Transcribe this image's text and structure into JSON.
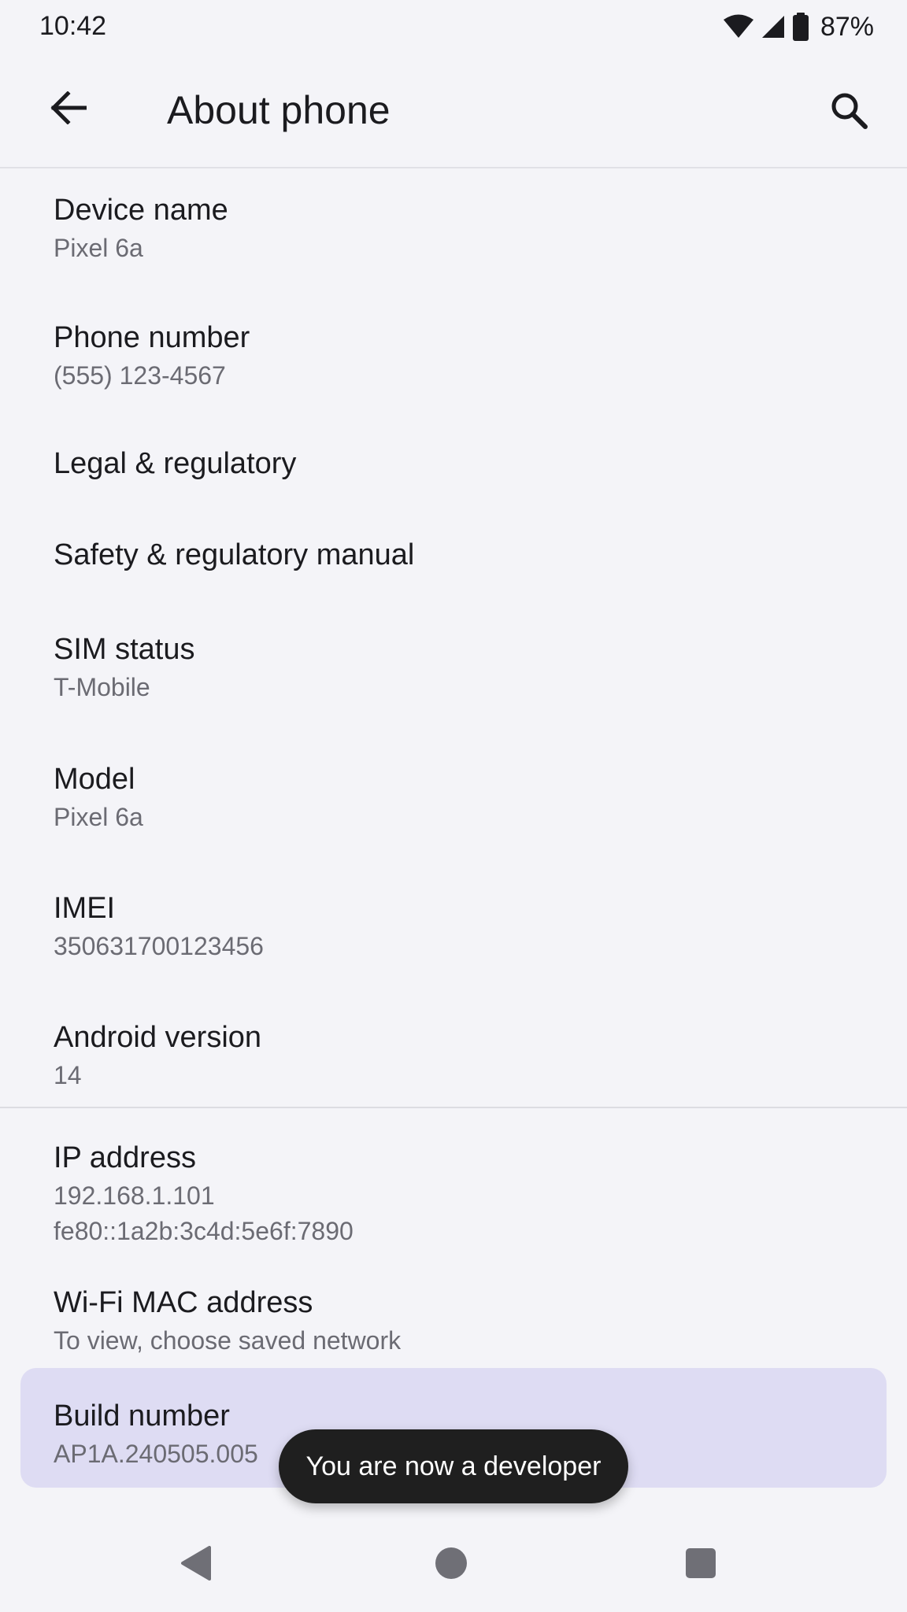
{
  "status_bar": {
    "time": "10:42",
    "battery": "87%",
    "icons": [
      "wifi-icon",
      "cell-signal-icon",
      "battery-icon"
    ]
  },
  "app_bar": {
    "title": "About phone",
    "back_icon": "back-arrow-icon",
    "search_icon": "search-icon"
  },
  "items": [
    {
      "title": "Device name",
      "summary": "Pixel 6a"
    },
    {
      "title": "Phone number",
      "summary": "(555) 123-4567"
    },
    {
      "title": "Legal & regulatory"
    },
    {
      "title": "Safety & regulatory manual"
    },
    {
      "title": "SIM status",
      "summary": "T-Mobile"
    },
    {
      "title": "Model",
      "summary": "Pixel 6a"
    },
    {
      "title": "IMEI",
      "summary": "350631700123456"
    },
    {
      "title": "Android version",
      "summary": "14"
    },
    {
      "title": "IP address",
      "summary": "192.168.1.101",
      "summary2": "fe80::1a2b:3c4d:5e6f:7890"
    },
    {
      "title": "Wi-Fi MAC address",
      "summary": "To view, choose saved network"
    },
    {
      "title": "Build number",
      "summary": "AP1A.240505.005",
      "highlighted": true
    }
  ],
  "toast": {
    "message": "You are now a developer"
  },
  "nav_bar": {
    "icons": [
      "back-triangle-icon",
      "home-circle-icon",
      "recents-square-icon"
    ]
  },
  "colors": {
    "background": "#f4f4f8",
    "highlight": "#dedcf3",
    "toast_bg": "#1f1f1f",
    "text_primary": "#1b1b1f",
    "text_secondary": "#6b6b73"
  }
}
